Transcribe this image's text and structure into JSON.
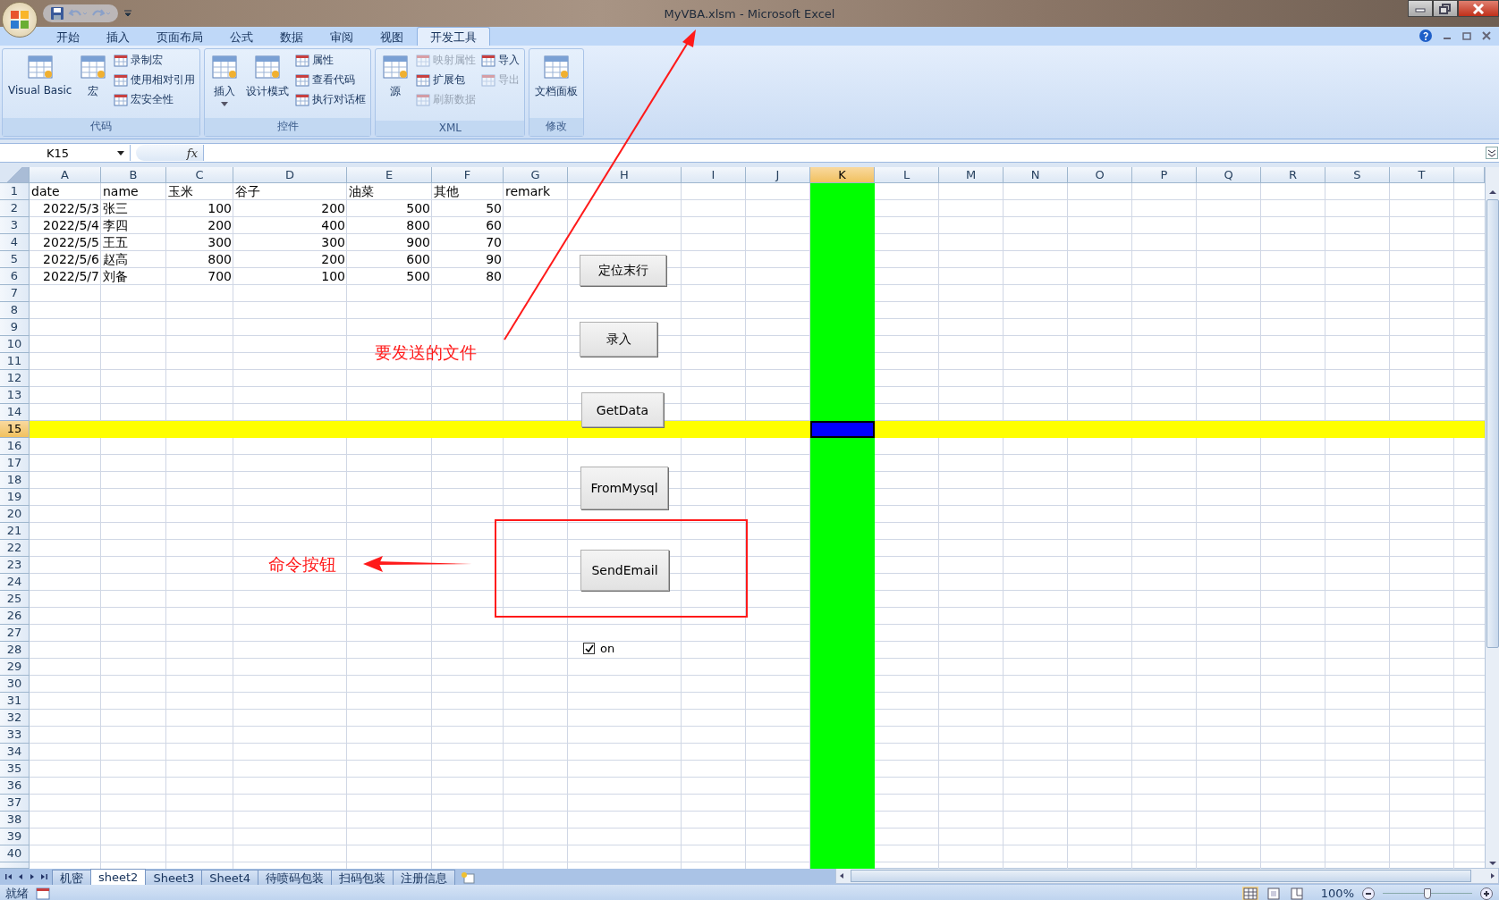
{
  "window": {
    "title": "MyVBA.xlsm - Microsoft Excel"
  },
  "ribbon_tabs": [
    {
      "label": "开始",
      "selected": false
    },
    {
      "label": "插入",
      "selected": false
    },
    {
      "label": "页面布局",
      "selected": false
    },
    {
      "label": "公式",
      "selected": false
    },
    {
      "label": "数据",
      "selected": false
    },
    {
      "label": "审阅",
      "selected": false
    },
    {
      "label": "视图",
      "selected": false
    },
    {
      "label": "开发工具",
      "selected": true
    }
  ],
  "ribbon_groups": [
    {
      "label": "代码",
      "items": [
        {
          "kind": "large",
          "label": "Visual Basic",
          "disabled": false
        },
        {
          "kind": "large",
          "label": "宏",
          "disabled": false
        },
        {
          "kind": "small",
          "label": "录制宏",
          "disabled": false
        },
        {
          "kind": "small",
          "label": "使用相对引用",
          "disabled": false
        },
        {
          "kind": "small",
          "label": "宏安全性",
          "disabled": false
        }
      ]
    },
    {
      "label": "控件",
      "items": [
        {
          "kind": "large",
          "label": "插入",
          "disabled": false,
          "dropdown": true
        },
        {
          "kind": "large",
          "label": "设计模式",
          "disabled": false
        },
        {
          "kind": "small",
          "label": "属性",
          "disabled": false
        },
        {
          "kind": "small",
          "label": "查看代码",
          "disabled": false
        },
        {
          "kind": "small",
          "label": "执行对话框",
          "disabled": false
        }
      ]
    },
    {
      "label": "XML",
      "items": [
        {
          "kind": "large",
          "label": "源",
          "disabled": false
        },
        {
          "kind": "small",
          "label": "映射属性",
          "disabled": true
        },
        {
          "kind": "small",
          "label": "扩展包",
          "disabled": false
        },
        {
          "kind": "small",
          "label": "刷新数据",
          "disabled": true
        },
        {
          "kind": "small",
          "label": "导入",
          "disabled": false
        },
        {
          "kind": "small",
          "label": "导出",
          "disabled": true
        }
      ]
    },
    {
      "label": "修改",
      "items": [
        {
          "kind": "large",
          "label": "文档面板",
          "disabled": false
        }
      ]
    }
  ],
  "formula_bar": {
    "name_box": "K15",
    "function_label": "fx"
  },
  "columns": [
    {
      "label": "A",
      "selected": false
    },
    {
      "label": "B",
      "selected": false
    },
    {
      "label": "C",
      "selected": false
    },
    {
      "label": "D",
      "selected": false
    },
    {
      "label": "E",
      "selected": false
    },
    {
      "label": "F",
      "selected": false
    },
    {
      "label": "G",
      "selected": false
    },
    {
      "label": "H",
      "selected": false
    },
    {
      "label": "I",
      "selected": false
    },
    {
      "label": "J",
      "selected": false
    },
    {
      "label": "K",
      "selected": true
    },
    {
      "label": "L",
      "selected": false
    },
    {
      "label": "M",
      "selected": false
    },
    {
      "label": "N",
      "selected": false
    },
    {
      "label": "O",
      "selected": false
    },
    {
      "label": "P",
      "selected": false
    },
    {
      "label": "Q",
      "selected": false
    },
    {
      "label": "R",
      "selected": false
    },
    {
      "label": "S",
      "selected": false
    },
    {
      "label": "T",
      "selected": false
    }
  ],
  "highlighted_column": {
    "color": "#00ff00"
  },
  "rows": [
    {
      "label": "1",
      "selected": false,
      "highlighted": false,
      "cells": [
        {
          "text": "date",
          "kind": "text"
        },
        {
          "text": "name",
          "kind": "text"
        },
        {
          "text": "玉米",
          "kind": "text"
        },
        {
          "text": "谷子",
          "kind": "text"
        },
        {
          "text": "油菜",
          "kind": "text"
        },
        {
          "text": "其他",
          "kind": "text"
        },
        {
          "text": "remark",
          "kind": "text"
        }
      ]
    },
    {
      "label": "2",
      "selected": false,
      "highlighted": false,
      "cells": [
        {
          "text": "2022/5/3",
          "kind": "number"
        },
        {
          "text": "张三",
          "kind": "text"
        },
        {
          "text": "100",
          "kind": "number"
        },
        {
          "text": "200",
          "kind": "number"
        },
        {
          "text": "500",
          "kind": "number"
        },
        {
          "text": "50",
          "kind": "number"
        }
      ]
    },
    {
      "label": "3",
      "selected": false,
      "highlighted": false,
      "cells": [
        {
          "text": "2022/5/4",
          "kind": "number"
        },
        {
          "text": "李四",
          "kind": "text"
        },
        {
          "text": "200",
          "kind": "number"
        },
        {
          "text": "400",
          "kind": "number"
        },
        {
          "text": "800",
          "kind": "number"
        },
        {
          "text": "60",
          "kind": "number"
        }
      ]
    },
    {
      "label": "4",
      "selected": false,
      "highlighted": false,
      "cells": [
        {
          "text": "2022/5/5",
          "kind": "number"
        },
        {
          "text": "王五",
          "kind": "text"
        },
        {
          "text": "300",
          "kind": "number"
        },
        {
          "text": "300",
          "kind": "number"
        },
        {
          "text": "900",
          "kind": "number"
        },
        {
          "text": "70",
          "kind": "number"
        }
      ]
    },
    {
      "label": "5",
      "selected": false,
      "highlighted": false,
      "cells": [
        {
          "text": "2022/5/6",
          "kind": "number"
        },
        {
          "text": "赵高",
          "kind": "text"
        },
        {
          "text": "800",
          "kind": "number"
        },
        {
          "text": "200",
          "kind": "number"
        },
        {
          "text": "600",
          "kind": "number"
        },
        {
          "text": "90",
          "kind": "number"
        }
      ]
    },
    {
      "label": "6",
      "selected": false,
      "highlighted": false,
      "cells": [
        {
          "text": "2022/5/7",
          "kind": "number"
        },
        {
          "text": "刘备",
          "kind": "text"
        },
        {
          "text": "700",
          "kind": "number"
        },
        {
          "text": "100",
          "kind": "number"
        },
        {
          "text": "500",
          "kind": "number"
        },
        {
          "text": "80",
          "kind": "number"
        }
      ]
    },
    {
      "label": "7",
      "selected": false,
      "highlighted": false
    },
    {
      "label": "8",
      "selected": false,
      "highlighted": false
    },
    {
      "label": "9",
      "selected": false,
      "highlighted": false
    },
    {
      "label": "10",
      "selected": false,
      "highlighted": false
    },
    {
      "label": "11",
      "selected": false,
      "highlighted": false
    },
    {
      "label": "12",
      "selected": false,
      "highlighted": false
    },
    {
      "label": "13",
      "selected": false,
      "highlighted": false
    },
    {
      "label": "14",
      "selected": false,
      "highlighted": false
    },
    {
      "label": "15",
      "selected": true,
      "highlighted": true
    },
    {
      "label": "16",
      "selected": false,
      "highlighted": false
    },
    {
      "label": "17",
      "selected": false,
      "highlighted": false
    },
    {
      "label": "18",
      "selected": false,
      "highlighted": false
    },
    {
      "label": "19",
      "selected": false,
      "highlighted": false
    },
    {
      "label": "20",
      "selected": false,
      "highlighted": false
    },
    {
      "label": "21",
      "selected": false,
      "highlighted": false
    },
    {
      "label": "22",
      "selected": false,
      "highlighted": false
    },
    {
      "label": "23",
      "selected": false,
      "highlighted": false
    },
    {
      "label": "24",
      "selected": false,
      "highlighted": false
    },
    {
      "label": "25",
      "selected": false,
      "highlighted": false
    },
    {
      "label": "26",
      "selected": false,
      "highlighted": false
    },
    {
      "label": "27",
      "selected": false,
      "highlighted": false
    },
    {
      "label": "28",
      "selected": false,
      "highlighted": false
    },
    {
      "label": "29",
      "selected": false,
      "highlighted": false
    },
    {
      "label": "30",
      "selected": false,
      "highlighted": false
    },
    {
      "label": "31",
      "selected": false,
      "highlighted": false
    },
    {
      "label": "32",
      "selected": false,
      "highlighted": false
    },
    {
      "label": "33",
      "selected": false,
      "highlighted": false
    },
    {
      "label": "34",
      "selected": false,
      "highlighted": false
    },
    {
      "label": "35",
      "selected": false,
      "highlighted": false
    },
    {
      "label": "36",
      "selected": false,
      "highlighted": false
    },
    {
      "label": "37",
      "selected": false,
      "highlighted": false
    },
    {
      "label": "38",
      "selected": false,
      "highlighted": false
    },
    {
      "label": "39",
      "selected": false,
      "highlighted": false
    },
    {
      "label": "40",
      "selected": false,
      "highlighted": false
    }
  ],
  "sheet_buttons": [
    {
      "label": "定位末行"
    },
    {
      "label": "录入"
    },
    {
      "label": "GetData"
    },
    {
      "label": "FromMysql"
    },
    {
      "label": "SendEmail"
    }
  ],
  "sheet_checkbox": {
    "label": "on",
    "checked": true
  },
  "annotations": [
    {
      "text": "要发送的文件"
    },
    {
      "text": "命令按钮"
    }
  ],
  "sheet_tabs": [
    {
      "label": "机密",
      "selected": false
    },
    {
      "label": "sheet2",
      "selected": true
    },
    {
      "label": "Sheet3",
      "selected": false
    },
    {
      "label": "Sheet4",
      "selected": false
    },
    {
      "label": "待喷码包装",
      "selected": false
    },
    {
      "label": "扫码包装",
      "selected": false
    },
    {
      "label": "注册信息",
      "selected": false
    }
  ],
  "status_bar": {
    "status": "就绪",
    "zoom": "100%",
    "zoom_slider": {
      "level": 0.5
    }
  }
}
